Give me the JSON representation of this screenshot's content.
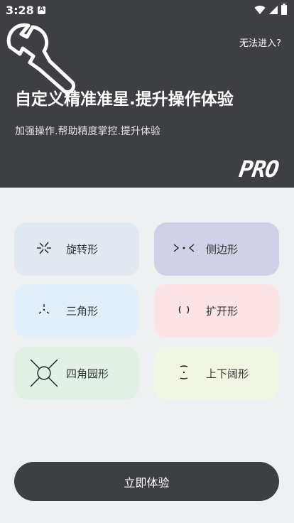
{
  "status_bar": {
    "time": "3:28"
  },
  "header": {
    "help_link": "无法进入?",
    "title": "自定义精准准星.提升操作体验",
    "subtitle": "加强操作.帮助精度掌控.提升体验",
    "badge": "PRO",
    "background_color": "#3e3f42"
  },
  "crosshair_types": [
    {
      "label": "旋转形",
      "icon": "rotate-crosshair-icon",
      "color": "#e3e9f1"
    },
    {
      "label": "侧边形",
      "icon": "side-crosshair-icon",
      "color": "#d0d0e8"
    },
    {
      "label": "三角形",
      "icon": "triangle-crosshair-icon",
      "color": "#e2effa"
    },
    {
      "label": "扩开形",
      "icon": "expand-crosshair-icon",
      "color": "#fde3e5"
    },
    {
      "label": "四角园形",
      "icon": "circle-crosshair-icon",
      "color": "#e2f0e6"
    },
    {
      "label": "上下阔形",
      "icon": "vertical-crosshair-icon",
      "color": "#f1f6e4"
    }
  ],
  "cta": {
    "label": "立即体验"
  }
}
